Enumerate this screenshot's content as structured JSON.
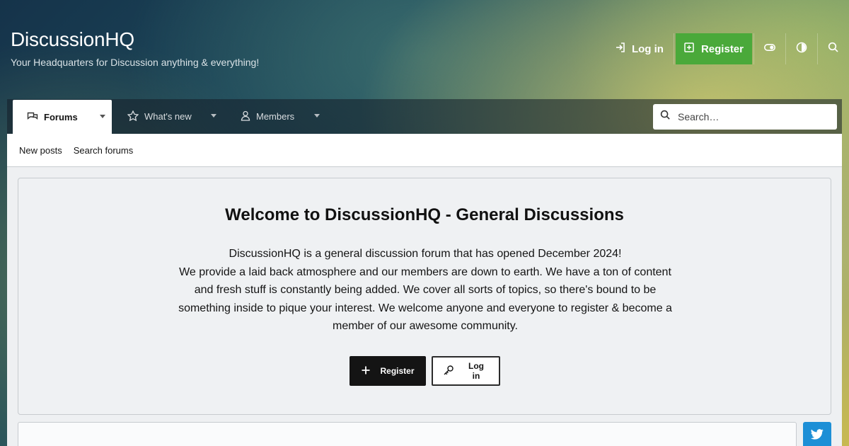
{
  "site": {
    "title": "DiscussionHQ",
    "tagline": "Your Headquarters for Discussion anything & everything!"
  },
  "header": {
    "login_label": "Log in",
    "register_label": "Register",
    "icons": [
      "sign-in-icon",
      "plus-square-icon",
      "toggle-icon",
      "contrast-icon",
      "search-icon"
    ],
    "register_color": "#4aa93a"
  },
  "nav": {
    "tabs": [
      {
        "label": "Forums",
        "icon": "comments-icon",
        "active": true
      },
      {
        "label": "What's new",
        "icon": "star-icon",
        "active": false
      },
      {
        "label": "Members",
        "icon": "user-icon",
        "active": false
      }
    ],
    "search_placeholder": "Search…"
  },
  "subnav": {
    "items": [
      "New posts",
      "Search forums"
    ]
  },
  "welcome": {
    "title": "Welcome to DiscussionHQ - General Discussions",
    "line1": "DiscussionHQ is a general discussion forum that has opened December 2024!",
    "line2": "We provide a laid back atmosphere and our members are down to earth. We have a ton of content and fresh stuff is constantly being added. We cover all sorts of topics, so there's bound to be something inside to pique your interest. We welcome anyone and everyone to register & become a member of our awesome community.",
    "register_label": "Register",
    "login_label": "Log in"
  },
  "share": {
    "twitter_icon": "twitter-icon",
    "twitter_color": "#1d8fd6"
  }
}
